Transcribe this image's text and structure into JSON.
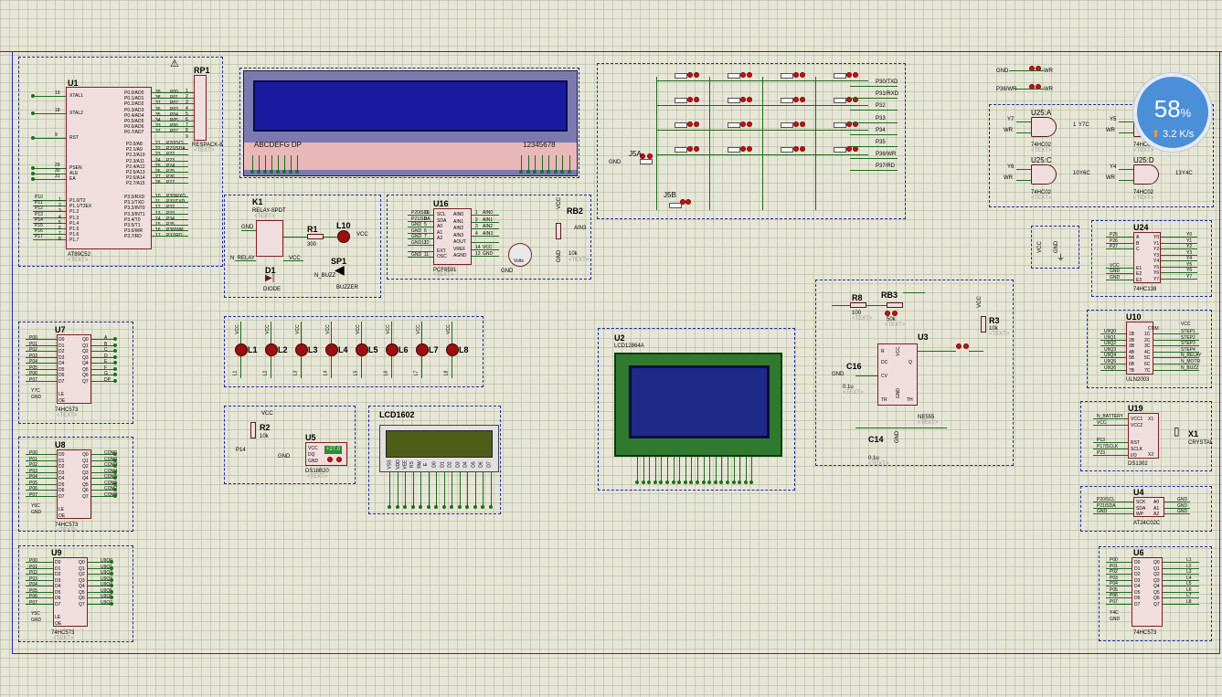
{
  "gauge": {
    "percent": "58",
    "unit": "%",
    "speed": "3.2 K/s",
    "arrow": "up-arrow-icon"
  },
  "colors": {
    "wire": "#1e6a1e",
    "frame": "#2a2aa0",
    "chip": "#f0dede",
    "pinhead": "#c41414",
    "gauge": "#4b8fd8"
  },
  "placeholder": "<TEXT>",
  "mcu": {
    "ref": "U1",
    "part": "AT89C52",
    "left_pins": [
      {
        "n": "19",
        "name": "XTAL1"
      },
      {
        "n": "18",
        "name": "XTAL2"
      },
      {
        "n": "9",
        "name": "RST"
      },
      {
        "n": "29",
        "name": "PSEN"
      },
      {
        "n": "30",
        "name": "ALE"
      },
      {
        "n": "31",
        "name": "EA"
      }
    ],
    "p1_nets": [
      "P10",
      "P11",
      "P12",
      "P13",
      "P14",
      "P15",
      "P16",
      "P17"
    ],
    "p1_pins": [
      "1",
      "2",
      "3",
      "4",
      "5",
      "6",
      "7",
      "8"
    ],
    "p1_names": [
      "P1.0/T2",
      "P1.1/T2EX",
      "P1.2",
      "P1.3",
      "P1.4",
      "P1.5",
      "P1.6",
      "P1.7"
    ],
    "p0_names": [
      "P0.0/AD0",
      "P0.1/AD1",
      "P0.2/AD2",
      "P0.3/AD3",
      "P0.4/AD4",
      "P0.5/AD5",
      "P0.6/AD6",
      "P0.7/AD7"
    ],
    "p0_pins": [
      "39",
      "38",
      "37",
      "36",
      "35",
      "34",
      "33",
      "32"
    ],
    "p0_nets": [
      "P00",
      "P01",
      "P02",
      "P03",
      "P04",
      "P05",
      "P06",
      "P07"
    ],
    "p2_names": [
      "P2.0/A8",
      "P2.1/A9",
      "P2.2/A10",
      "P2.3/A11",
      "P2.4/A12",
      "P2.5/A13",
      "P2.6/A14",
      "P2.7/A15"
    ],
    "p2_pins": [
      "21",
      "22",
      "23",
      "24",
      "25",
      "26",
      "27",
      "28"
    ],
    "p2_nets": [
      "P20/SCL",
      "P21/SDA",
      "P22",
      "P23",
      "P24",
      "P25",
      "P26",
      "P27"
    ],
    "p3_names": [
      "P3.0/RXD",
      "P3.1/TXD",
      "P3.2/INT0",
      "P3.3/INT1",
      "P3.4/T0",
      "P3.5/T1",
      "P3.6/WR",
      "P3.7/RD"
    ],
    "p3_pins": [
      "10",
      "11",
      "12",
      "13",
      "14",
      "15",
      "16",
      "17"
    ],
    "p3_nets": [
      "P30/RXD",
      "P31/TXD",
      "P32",
      "P33",
      "P34",
      "P35",
      "P36/WR",
      "P37/RD"
    ]
  },
  "rp1": {
    "ref": "RP1",
    "part": "RESPACK-8",
    "pins": [
      "1",
      "2",
      "3",
      "4",
      "5",
      "6",
      "7",
      "8",
      "9"
    ],
    "nets": [
      "P00",
      "P01",
      "P02",
      "P03",
      "P04",
      "P05",
      "P06",
      "P07"
    ]
  },
  "lcd_top": {
    "left": "ABCDEFG DP",
    "right": "12345678"
  },
  "keypad": {
    "nets": [
      "P30/TXD",
      "P31/RXD",
      "P32",
      "P33",
      "P34",
      "P35",
      "P36/WR",
      "P37/RD"
    ],
    "j5a": "J5A",
    "j5b": "J5B",
    "gnd": "GND"
  },
  "k1": {
    "ref": "K1",
    "part": "RELAY-SPDT",
    "gnd": "GND",
    "net": "N_RELAY",
    "vcc": "VCC",
    "d1": "D1",
    "diode": "DIODE",
    "r1": "R1",
    "r1v": "300",
    "l10": "L10",
    "vcc2": "VCC",
    "sp1": "SP1",
    "buzz": "N_BUZZ",
    "buzzer": "BUZZER"
  },
  "u16": {
    "ref": "U16",
    "part": "PCF8591",
    "left": [
      "P20/SCL",
      "P21/SDA",
      "GND",
      "GND",
      "GND",
      "GND12",
      "",
      "GND"
    ],
    "left_pins": [
      "10",
      "9",
      "5",
      "6",
      "7",
      "12",
      "",
      "11"
    ],
    "lnames": [
      "SCL",
      "SDA",
      "A0",
      "A1",
      "A2",
      "",
      "EXT",
      "OSC"
    ],
    "rnames": [
      "AIN0",
      "AIN1",
      "AIN2",
      "AIN3",
      "AOUT",
      "VREF",
      "AGND"
    ],
    "rpins": [
      "1",
      "2",
      "3",
      "4",
      "",
      "14",
      "13"
    ],
    "rnets": [
      "AIN0",
      "AIN1",
      "AIN2",
      "AIN3",
      "",
      "VCC",
      "GND"
    ],
    "volts": "Volts",
    "vgnd": "GND"
  },
  "rb2": {
    "ref": "RB2",
    "vcc": "VCC",
    "gnd": "GND",
    "val": "10k",
    "ain": "AIN3"
  },
  "leds": [
    "L1",
    "L2",
    "L3",
    "L4",
    "L5",
    "L6",
    "L7",
    "L8"
  ],
  "u7": {
    "ref": "U7",
    "part": "74HC573",
    "ins": [
      "P00",
      "P01",
      "P02",
      "P03",
      "P04",
      "P05",
      "P06",
      "P07"
    ],
    "inames": [
      "D0",
      "D1",
      "D2",
      "D3",
      "D4",
      "D5",
      "D6",
      "D7"
    ],
    "onames": [
      "Q0",
      "Q1",
      "Q2",
      "Q3",
      "Q4",
      "Q5",
      "Q6",
      "Q7"
    ],
    "outs": [
      "A",
      "B",
      "C",
      "D",
      "E",
      "F",
      "G",
      "DP"
    ],
    "le": "Y7C",
    "gnd": "GND"
  },
  "u8": {
    "ref": "U8",
    "part": "74HC573",
    "ins": [
      "P00",
      "P01",
      "P02",
      "P03",
      "P04",
      "P05",
      "P06",
      "P07"
    ],
    "outs": [
      "COM1",
      "COM2",
      "COM3",
      "COM4",
      "COM5",
      "COM6",
      "COM7",
      "COM8"
    ],
    "le": "Y6C",
    "gnd": "GND"
  },
  "u9": {
    "ref": "U9",
    "part": "74HC573",
    "ins": [
      "P00",
      "P01",
      "P02",
      "P03",
      "P04",
      "P05",
      "P06",
      "P07"
    ],
    "outs": [
      "U9Q0",
      "U9Q1",
      "U9Q2",
      "U9Q3",
      "U9Q4",
      "U9Q5",
      "U9Q6",
      "U9Q7"
    ],
    "le": "Y5C",
    "gnd": "GND"
  },
  "u5": {
    "ref": "U5",
    "part": "DS18B20",
    "vcc": "VCC",
    "r2": "R2",
    "r2v": "10k",
    "net": "P14",
    "gnd": "GND",
    "pins": [
      "VCC",
      "DQ",
      "GND"
    ],
    "reading": "+27.0"
  },
  "lcd1602": {
    "ref": "LCD1602",
    "pins": [
      "VSS",
      "VDD",
      "VEE",
      "RS",
      "RW",
      "E",
      "D0",
      "D1",
      "D2",
      "D3",
      "D4",
      "D5",
      "D6",
      "D7"
    ]
  },
  "u2": {
    "ref": "U2",
    "part": "LCD12864A"
  },
  "u3": {
    "ref": "U3",
    "part": "NE555",
    "r8": "R8",
    "r8v": "100",
    "rb3": "RB3",
    "rb3v": "50k",
    "c16": "C16",
    "c16v": "0.1u",
    "c14": "C14",
    "c14v": "0.1u",
    "gnd": "GND",
    "vcc": "VCC",
    "r3": "R3",
    "r3v": "10k",
    "pins": [
      "R",
      "DC",
      "Q",
      "CV",
      "TR",
      "TH",
      "GND",
      "VCC"
    ]
  },
  "wr": {
    "a": "GND",
    "b": "P36/WR",
    "net": "WR"
  },
  "u25": {
    "a": "U25:A",
    "c": "U25:C",
    "d": "U25:D",
    "part": "74HC02",
    "y7": "Y7",
    "y6": "Y6",
    "y5": "Y5",
    "y4": "Y4",
    "wr": "WR",
    "o1": "Y7C",
    "o2": "Y6C",
    "o3": "Y4C",
    "n1": "1",
    "n2": "10",
    "n3": "13"
  },
  "vccgnd": {
    "vcc": "VCC",
    "gnd": "GND"
  },
  "u24": {
    "ref": "U24",
    "part": "74HC138",
    "ins": [
      "P25",
      "P26",
      "P27",
      "VCC",
      "GND",
      "GND"
    ],
    "inames": [
      "A",
      "B",
      "C",
      "E1",
      "E2",
      "E3"
    ],
    "outs": [
      "Y0",
      "Y1",
      "Y2",
      "Y3",
      "Y4",
      "Y5",
      "Y6",
      "Y7"
    ]
  },
  "u10": {
    "ref": "U10",
    "part": "ULN2003",
    "ins": [
      "U9Q0",
      "U9Q1",
      "U9Q2",
      "U9Q3",
      "U9Q4",
      "U9Q5",
      "U9Q6"
    ],
    "outs": [
      "STEP1",
      "STEP2",
      "STEP3",
      "STEP4",
      "N_RELAY",
      "N_MOTR",
      "N_BUZZ"
    ],
    "com": "COM",
    "vcc": "VCC"
  },
  "u19": {
    "ref": "U19",
    "part": "DS1302",
    "x1": "X1",
    "crystal": "CRYSTAL",
    "ins": [
      "N_BATTERY",
      "VCC",
      "P13",
      "P17/SCLK",
      "P23"
    ],
    "inames": [
      "VCC1",
      "VCC2",
      "RST",
      "SCLK",
      "I/O"
    ],
    "rnames": [
      "X1",
      "X2"
    ]
  },
  "u4": {
    "ref": "U4",
    "part": "AT24C02C",
    "ins": [
      "P20/SCL",
      "P21/SDA",
      "GND"
    ],
    "inames": [
      "SCK",
      "SDA",
      "WP"
    ],
    "rnames": [
      "A0",
      "A1",
      "A2"
    ],
    "outs": [
      "GND",
      "GND",
      "GND"
    ]
  },
  "u6": {
    "ref": "U6",
    "part": "74HC573",
    "ins": [
      "P00",
      "P01",
      "P02",
      "P03",
      "P04",
      "P05",
      "P06",
      "P07"
    ],
    "outs": [
      "L1",
      "L2",
      "L3",
      "L4",
      "L5",
      "L6",
      "L7",
      "L8"
    ],
    "le": "Y4C",
    "gnd": "GND"
  }
}
